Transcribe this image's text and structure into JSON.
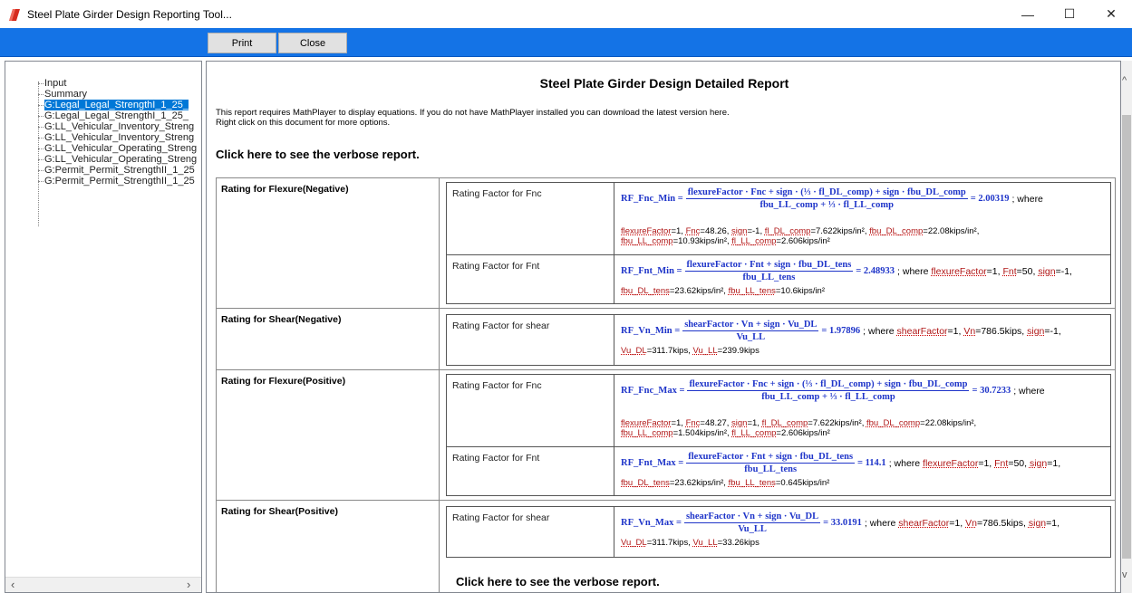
{
  "window": {
    "title": "Steel Plate Girder Design Reporting Tool...",
    "minimize_glyph": "—",
    "maximize_glyph": "☐",
    "close_glyph": "✕",
    "icon": "red-flag-app-icon"
  },
  "toolbar": {
    "print_label": "Print",
    "close_label": "Close",
    "accent": "#1473e6"
  },
  "tree": {
    "items": [
      {
        "label": "Input"
      },
      {
        "label": "Summary"
      },
      {
        "label": "G:Legal_Legal_StrengthI_1_25_"
      },
      {
        "label": "G:Legal_Legal_StrengthI_1_25_"
      },
      {
        "label": "G:LL_Vehicular_Inventory_Streng"
      },
      {
        "label": "G:LL_Vehicular_Inventory_Streng"
      },
      {
        "label": "G:LL_Vehicular_Operating_Streng"
      },
      {
        "label": "G:LL_Vehicular_Operating_Streng"
      },
      {
        "label": "G:Permit_Permit_StrengthII_1_25"
      },
      {
        "label": "G:Permit_Permit_StrengthII_1_25"
      }
    ],
    "selected_index": 2,
    "scroll_left": "‹",
    "scroll_right": "›"
  },
  "report": {
    "title": "Steel Plate Girder Design Detailed Report",
    "notice_line1": "This report requires MathPlayer to display equations. If you do not have MathPlayer installed you can download the latest version here.",
    "notice_line2": "Right click on this document for more options.",
    "verbose_link": "Click here to see the verbose report.",
    "scroll_up": "^",
    "scroll_down": "v",
    "sections": [
      {
        "label": "Rating for Flexure(Negative)",
        "rows": [
          {
            "label": "Rating Factor for Fnc",
            "lhs": "RF_Fnc_Min =",
            "num": "flexureFactor · Fnc + sign · (⅓ · fl_DL_comp) + sign · fbu_DL_comp",
            "den": "fbu_LL_comp + ⅓ · fl_LL_comp",
            "result": "= 2.00319",
            "tail": "; where",
            "vars_line1": "flexureFactor=1, Fnc=48.26, sign=-1, fl_DL_comp=7.622kips/in², fbu_DL_comp=22.08kips/in²,",
            "vars_line2": "fbu_LL_comp=10.93kips/in², fl_LL_comp=2.606kips/in²"
          },
          {
            "label": "Rating Factor for Fnt",
            "lhs": "RF_Fnt_Min =",
            "num": "flexureFactor · Fnt + sign · fbu_DL_tens",
            "den": "fbu_LL_tens",
            "result": "= 2.48933",
            "tail": "; where flexureFactor=1, Fnt=50, sign=-1,",
            "vars_line1": "fbu_DL_tens=23.62kips/in², fbu_LL_tens=10.6kips/in²",
            "vars_line2": ""
          }
        ]
      },
      {
        "label": "Rating for Shear(Negative)",
        "rows": [
          {
            "label": "Rating Factor for shear",
            "lhs": "RF_Vn_Min =",
            "num": "shearFactor · Vn + sign · Vu_DL",
            "den": "Vu_LL",
            "result": "= 1.97896",
            "tail": "; where shearFactor=1, Vn=786.5kips, sign=-1,",
            "vars_line1": "Vu_DL=311.7kips, Vu_LL=239.9kips",
            "vars_line2": ""
          }
        ]
      },
      {
        "label": "Rating for Flexure(Positive)",
        "rows": [
          {
            "label": "Rating Factor for Fnc",
            "lhs": "RF_Fnc_Max =",
            "num": "flexureFactor · Fnc + sign · (⅓ · fl_DL_comp) + sign · fbu_DL_comp",
            "den": "fbu_LL_comp + ⅓ · fl_LL_comp",
            "result": "= 30.7233",
            "tail": "; where",
            "vars_line1": "flexureFactor=1, Fnc=48.27, sign=1, fl_DL_comp=7.622kips/in², fbu_DL_comp=22.08kips/in²,",
            "vars_line2": "fbu_LL_comp=1.504kips/in², fl_LL_comp=2.606kips/in²"
          },
          {
            "label": "Rating Factor for Fnt",
            "lhs": "RF_Fnt_Max =",
            "num": "flexureFactor · Fnt + sign · fbu_DL_tens",
            "den": "fbu_LL_tens",
            "result": "= 114.1",
            "tail": "; where flexureFactor=1, Fnt=50, sign=1,",
            "vars_line1": "fbu_DL_tens=23.62kips/in², fbu_LL_tens=0.645kips/in²",
            "vars_line2": ""
          }
        ]
      },
      {
        "label": "Rating for Shear(Positive)",
        "rows": [
          {
            "label": "Rating Factor for shear",
            "lhs": "RF_Vn_Max =",
            "num": "shearFactor · Vn + sign · Vu_DL",
            "den": "Vu_LL",
            "result": "= 33.0191",
            "tail": "; where shearFactor=1, Vn=786.5kips, sign=1,",
            "vars_line1": "Vu_DL=311.7kips, Vu_LL=33.26kips",
            "vars_line2": ""
          }
        ]
      }
    ]
  }
}
